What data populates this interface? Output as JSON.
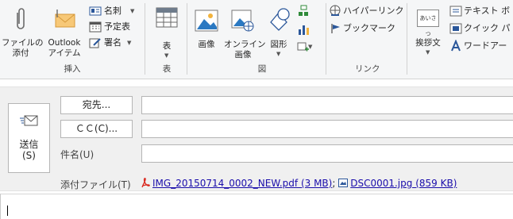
{
  "ribbon": {
    "insert_group": {
      "label": "挿入",
      "attach_file": [
        "ファイルの",
        "添付"
      ],
      "outlook_item": [
        "Outlook",
        "アイテム"
      ],
      "business_card": "名刺",
      "calendar": "予定表",
      "signature": "署名"
    },
    "tables_group": {
      "label": "表",
      "table": "表"
    },
    "illustrations_group": {
      "label": "図",
      "pictures": "画像",
      "online_pictures": [
        "オンライン",
        "画像"
      ],
      "shapes": "図形"
    },
    "links_group": {
      "label": "リンク",
      "hyperlink": "ハイパーリンク",
      "bookmark": "ブックマーク"
    },
    "text_group": {
      "greeting": "挨拶文",
      "greeting_badge": "あいさつ",
      "text_box": "テキスト ボ",
      "quick_parts": "クイック パ",
      "wordart": "ワードアー"
    }
  },
  "compose": {
    "send": {
      "line1": "送信",
      "line2": "(S)"
    },
    "to_button": "宛先...",
    "cc_button": "ＣＣ(C)...",
    "subject_label": "件名(U)",
    "attached_label": "添付ファイル(T)",
    "attachments": [
      {
        "name": "IMG_20150714_0002_NEW.pdf (3 MB)",
        "type": "pdf"
      },
      {
        "name": "DSC0001.jpg (859 KB)",
        "type": "jpg"
      }
    ],
    "attachment_separator": ";"
  },
  "colors": {
    "accent": "#2b579a",
    "pdf": "#d9261c",
    "ribbon_bg": "#f5f6f7",
    "panel_bg": "#f0f0f0"
  }
}
